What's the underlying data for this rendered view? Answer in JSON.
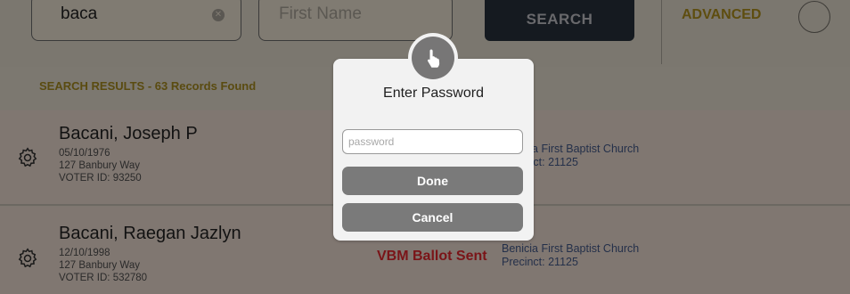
{
  "search": {
    "last_name_value": "baca",
    "first_name_placeholder": "First Name",
    "search_label": "SEARCH",
    "advanced_label": "ADVANCED"
  },
  "results": {
    "label": "SEARCH RESULTS - 63 Records Found",
    "voters": [
      {
        "name": "Bacani, Joseph P",
        "dob": "05/10/1976",
        "address": "127 Banbury Way",
        "voter_id": "VOTER ID: 93250",
        "church": "Benicia First Baptist Church",
        "church_visible": "a First Baptist Church",
        "precinct": "Precinct: 21125",
        "precinct_visible": "cinct: 21125",
        "status": ""
      },
      {
        "name": "Bacani, Raegan Jazlyn",
        "dob": "12/10/1998",
        "address": "127 Banbury Way",
        "voter_id": "VOTER ID: 532780",
        "church": "Benicia First Baptist Church",
        "precinct": "Precinct: 21125",
        "status": "VBM Ballot Sent"
      }
    ]
  },
  "modal": {
    "title": "Enter Password",
    "password_placeholder": "password",
    "done_label": "Done",
    "cancel_label": "Cancel"
  },
  "icons": {
    "badge": "hand-pointer-icon",
    "row_action": "gear-icon",
    "clear": "clear-icon"
  },
  "colors": {
    "overlay": "#7d7870",
    "modal_bg": "#f2f2f2",
    "modal_button": "#7a7a7a",
    "search_button": "#151a20",
    "advanced_text": "#5e4d0f",
    "vbm_status": "#7a1418"
  }
}
